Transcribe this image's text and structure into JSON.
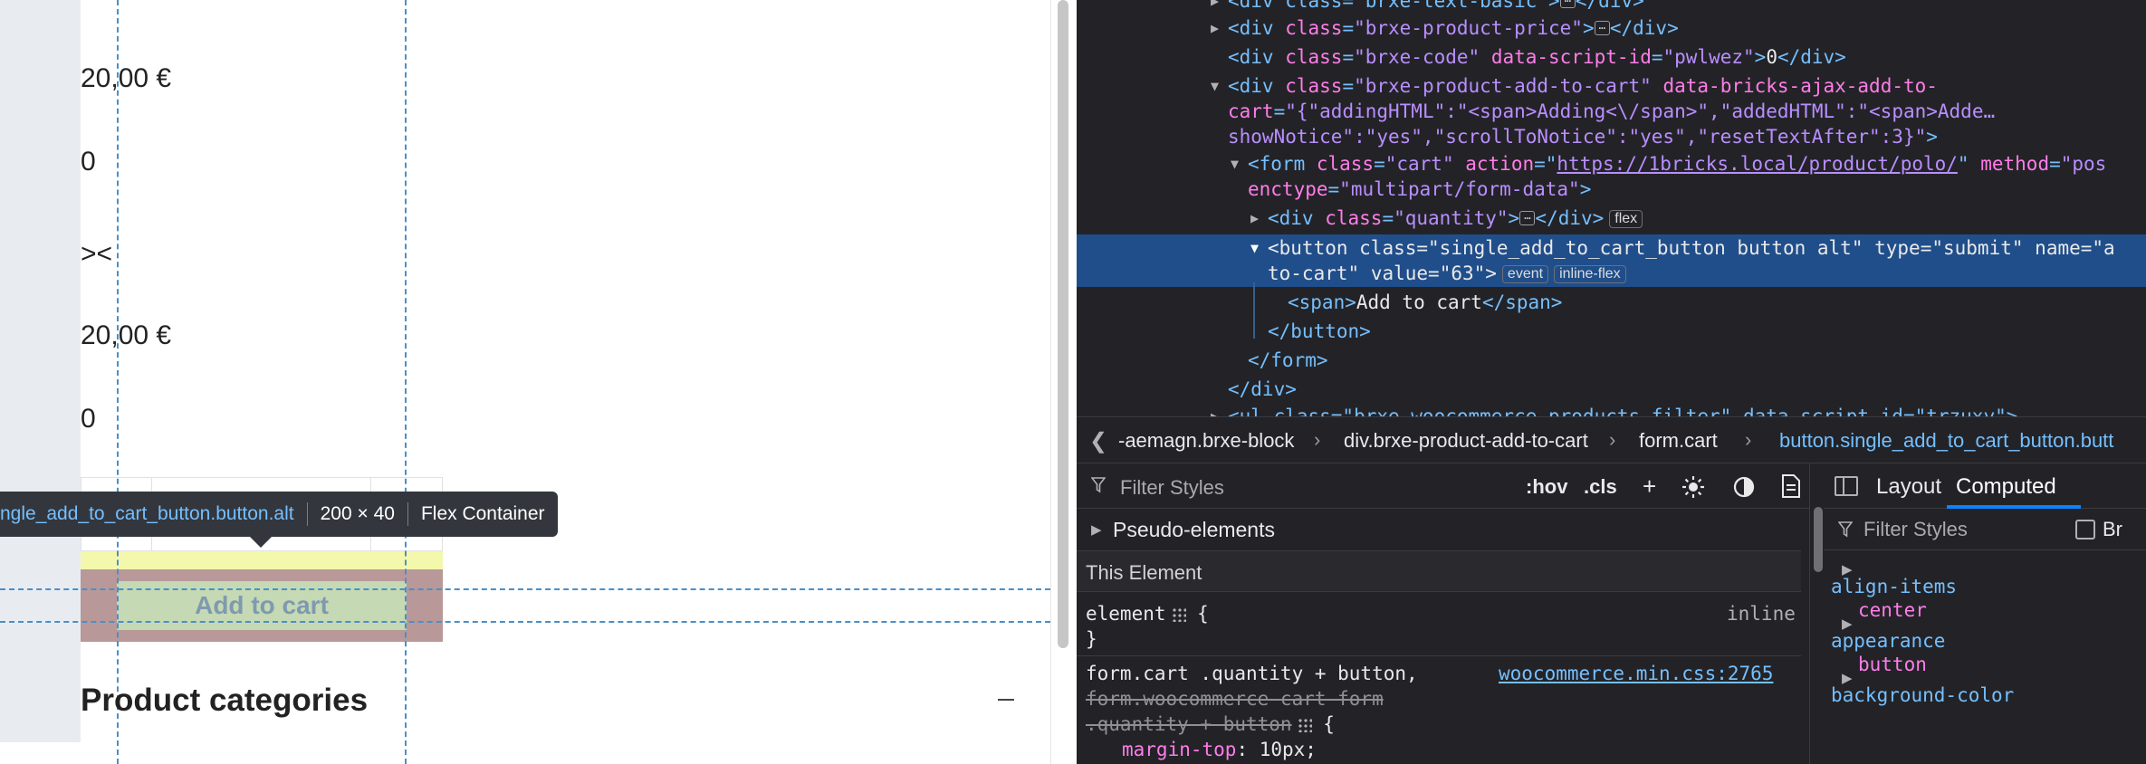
{
  "preview": {
    "price_1": "20,00 €",
    "zero_1": "0",
    "arrows": "><",
    "price_2": "20,00 €",
    "zero_2": "0",
    "add_to_cart_label": "Add to cart",
    "product_categories": "Product categories",
    "tooltip": {
      "selector": "ngle_add_to_cart_button.button.alt",
      "size": "200 × 40",
      "kind": "Flex Container"
    }
  },
  "devtools": {
    "tree": {
      "l0_tag": "<div class=\"brxe-text-basic\">",
      "l0_close": "</div>",
      "l1_open": "<div ",
      "l1_attr": "class",
      "l1_val": "\"brxe-product-price\"",
      "l1_close": "</div>",
      "l2_open": "<div ",
      "l2_attr1": "class",
      "l2_val1": "\"brxe-code\"",
      "l2_attr2": "data-script-id",
      "l2_val2": "\"pwlwez\"",
      "l2_text": "0",
      "l2_close": "</div>",
      "l3_open": "<div ",
      "l3_attr1": "class",
      "l3_val1": "\"brxe-product-add-to-cart\"",
      "l3_attr2": "data-bricks-ajax-add-to-",
      "l4_cont": "cart",
      "l4_val": "\"{\"addingHTML\":\"<span>Adding<\\/span>\",\"addedHTML\":\"<span>Adde…",
      "l5_val": "showNotice\":\"yes\",\"scrollToNotice\":\"yes\",\"resetTextAfter\":3}\"",
      "l5_close": ">",
      "l6_open": "<form ",
      "l6_attr1": "class",
      "l6_val1": "\"cart\"",
      "l6_attr2": "action",
      "l6_link": "https://1bricks.local/product/polo/",
      "l6_attr3": "method",
      "l6_val3": "\"pos",
      "l7_attr": "enctype",
      "l7_val": "\"multipart/form-data\"",
      "l7_close": ">",
      "l8_open": "<div ",
      "l8_attr": "class",
      "l8_val": "\"quantity\"",
      "l8_close": "</div>",
      "l8_badge": "flex",
      "l9_open": "<button ",
      "l9_attr1": "class",
      "l9_val1": "\"single_add_to_cart_button button alt\"",
      "l9_attr2": "type",
      "l9_val2": "\"submit\"",
      "l9_attr3": "name",
      "l9_val3": "\"a",
      "l10_cont": "to-cart\"",
      "l10_attr": "value",
      "l10_val": "\"63\"",
      "l10_close": ">",
      "l10_badge1": "event",
      "l10_badge2": "inline-flex",
      "l11_open": "<span>",
      "l11_text": "Add to cart",
      "l11_close": "</span>",
      "l12": "</button>",
      "l13": "</form>",
      "l14": "</div>",
      "l15": "<ul class=\"brxe-woocommerce-products-filter\" data-script-id=\"trzuxy\">"
    },
    "breadcrumbs": [
      "-aemagn.brxe-block",
      "div.brxe-product-add-to-cart",
      "form.cart",
      "button.single_add_to_cart_button.butt"
    ],
    "rules": {
      "filter_placeholder": "Filter Styles",
      "hov": ":hov",
      "cls": ".cls",
      "pseudo_elements": "Pseudo-elements",
      "this_element": "This Element",
      "element_open": "element",
      "element_brace": "{",
      "inline": "inline",
      "element_close": "}",
      "rule2_sel1": "form.cart .quantity + button,",
      "rule2_src": "woocommerce.min.css:2765",
      "rule2_sel2": "form.woocommerce-cart-form",
      "rule2_sel3": ".quantity + button",
      "rule2_brace": "{",
      "rule2_prop": "margin-top",
      "rule2_val": "10px;"
    },
    "computed": {
      "tab_layout": "Layout",
      "tab_computed": "Computed",
      "filter_placeholder": "Filter Styles",
      "browser_styles": "Br",
      "props": [
        {
          "name": "align-items",
          "value": "center"
        },
        {
          "name": "appearance",
          "value": "button"
        },
        {
          "name": "background-color",
          "value": ""
        }
      ]
    }
  },
  "colors": {
    "selected_row": "#204e8a",
    "devtools_bg": "#232327",
    "margin_highlight": "#f3f8ad",
    "border_highlight": "#b89898",
    "content_highlight": "#c4d9b4",
    "guide": "#4a8fc9"
  }
}
